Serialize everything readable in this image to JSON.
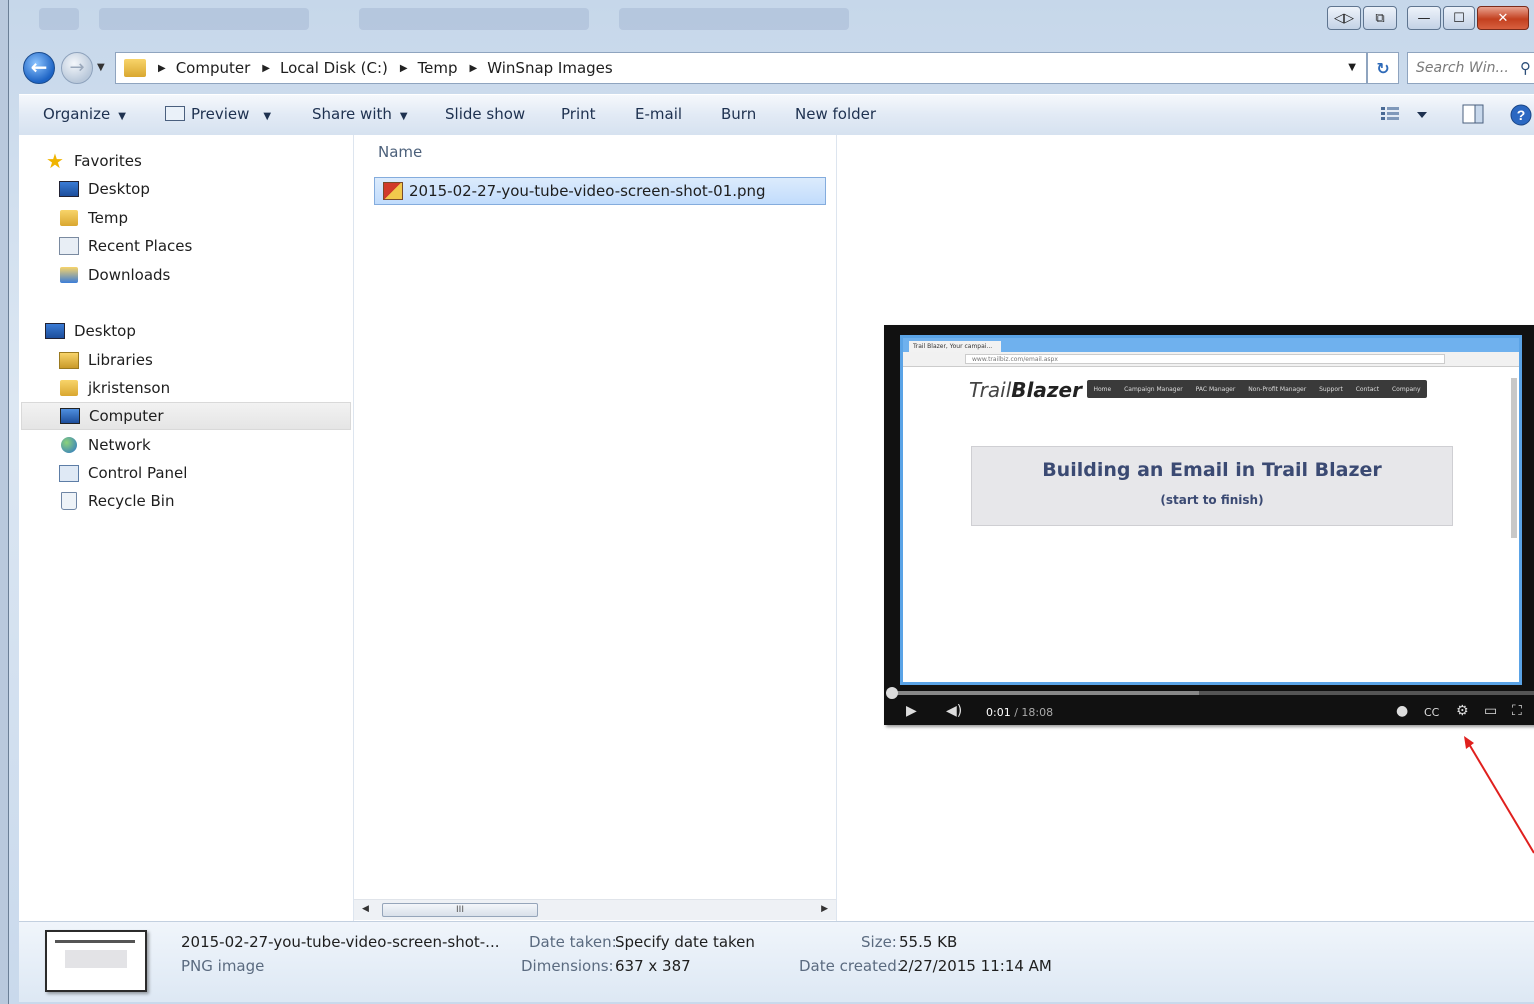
{
  "titlebar": {
    "buttons": [
      "◁▷",
      "⧉",
      "—",
      "☐",
      "✕"
    ]
  },
  "address": {
    "crumbs": [
      "Computer",
      "Local Disk (C:)",
      "Temp",
      "WinSnap Images"
    ],
    "search_placeholder": "Search Win..."
  },
  "toolbar": {
    "organize": "Organize",
    "preview": "Preview",
    "share_with": "Share with",
    "slide_show": "Slide show",
    "print": "Print",
    "email": "E-mail",
    "burn": "Burn",
    "new_folder": "New folder"
  },
  "navigation": {
    "favorites_header": "Favorites",
    "favorites": [
      {
        "label": "Desktop",
        "icon": "desktop-icon"
      },
      {
        "label": "Temp",
        "icon": "folder-icon"
      },
      {
        "label": "Recent Places",
        "icon": "recent-places-icon"
      },
      {
        "label": "Downloads",
        "icon": "downloads-icon"
      }
    ],
    "tree_header": "Desktop",
    "tree": [
      {
        "label": "Libraries",
        "icon": "libraries-icon"
      },
      {
        "label": "jkristenson",
        "icon": "user-folder-icon"
      },
      {
        "label": "Computer",
        "icon": "computer-icon",
        "selected": true
      },
      {
        "label": "Network",
        "icon": "network-icon"
      },
      {
        "label": "Control Panel",
        "icon": "control-panel-icon"
      },
      {
        "label": "Recycle Bin",
        "icon": "recycle-bin-icon"
      }
    ]
  },
  "files": {
    "column_name": "Name",
    "items": [
      {
        "name": "2015-02-27-you-tube-video-screen-shot-01.png",
        "selected": true
      }
    ],
    "scroll_grip": "III"
  },
  "preview_image": {
    "tab_text": "Trail Blazer, Your campai...",
    "url_text": "www.trailbiz.com/email.aspx",
    "logo_light": "Trail",
    "logo_bold": "Blazer",
    "nav_items": [
      "Home",
      "Campaign Manager",
      "PAC Manager",
      "Non-Profit Manager",
      "Support",
      "Contact",
      "Company"
    ],
    "heading": "Building an Email in Trail Blazer",
    "subheading": "(start to finish)",
    "time_current": "0:01",
    "time_total": " / 18:08",
    "progress_fraction": 0.48
  },
  "details": {
    "filename": "2015-02-27-you-tube-video-screen-shot-...",
    "filetype": "PNG image",
    "date_taken_label": "Date taken:",
    "date_taken_value": "Specify date taken",
    "dimensions_label": "Dimensions:",
    "dimensions_value": "637 x 387",
    "size_label": "Size:",
    "size_value": "55.5 KB",
    "date_created_label": "Date created:",
    "date_created_value": "2/27/2015 11:14 AM"
  },
  "colors": {
    "selection": "#c1dcfc",
    "annotation_arrow": "#e0201e",
    "video_heading": "#3b4a73"
  }
}
